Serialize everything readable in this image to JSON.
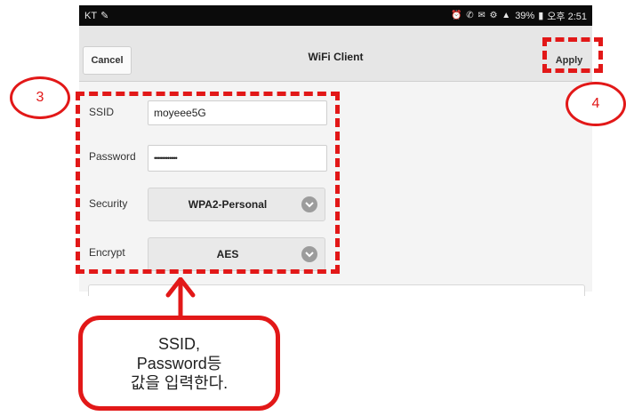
{
  "status_bar": {
    "carrier": "KT",
    "right_text": "39%",
    "time": "오후 2:51"
  },
  "toolbar": {
    "cancel_label": "Cancel",
    "title": "WiFi Client",
    "apply_label": "Apply"
  },
  "form": {
    "ssid": {
      "label": "SSID",
      "value": "moyeee5G"
    },
    "password": {
      "label": "Password",
      "value": "••••••••••••"
    },
    "security": {
      "label": "Security",
      "value": "WPA2-Personal"
    },
    "encrypt": {
      "label": "Encrypt",
      "value": "AES"
    }
  },
  "annotations": {
    "step3": "3",
    "step4": "4",
    "callout_lines": [
      "SSID,",
      "Password등",
      "값을 입력한다."
    ]
  },
  "colors": {
    "annotation": "#e21818",
    "status_bg": "#0b0b0b"
  }
}
